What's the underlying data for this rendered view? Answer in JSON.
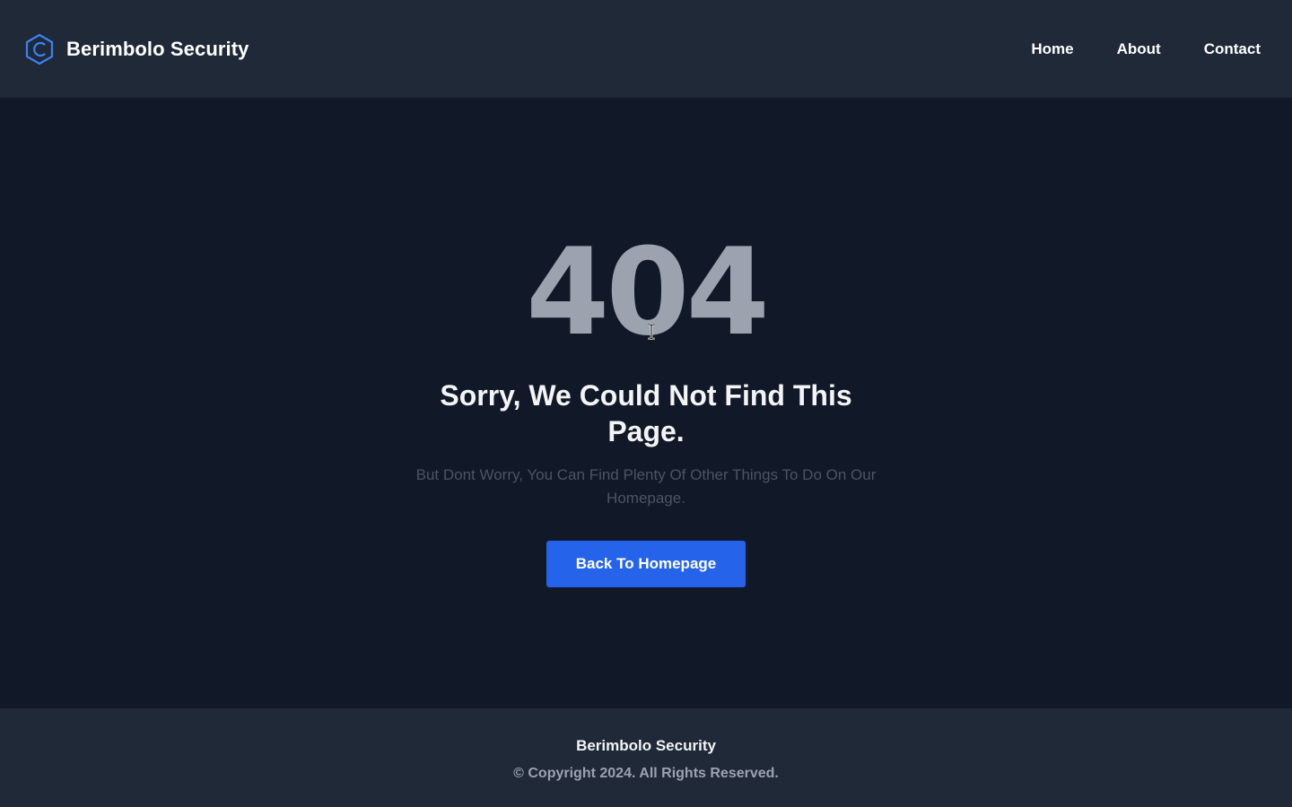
{
  "header": {
    "brand_name": "Berimbolo Security",
    "logo_icon": "hexagon-c-logo-icon",
    "nav": [
      {
        "label": "Home"
      },
      {
        "label": "About"
      },
      {
        "label": "Contact"
      }
    ]
  },
  "main": {
    "error_code": "404",
    "title": "Sorry, We Could Not Find This Page.",
    "subtitle": "But Dont Worry, You Can Find Plenty Of Other Things To Do On Our Homepage.",
    "cta_label": "Back To Homepage",
    "cursor_icon": "text-cursor-icon"
  },
  "footer": {
    "brand_name": "Berimbolo Security",
    "copyright": "© Copyright 2024. All Rights Reserved."
  },
  "colors": {
    "header_bg": "#1f2937",
    "page_bg": "#111827",
    "accent": "#2563eb",
    "logo": "#3b82f6",
    "error_code": "#9ca3af",
    "subtitle": "#4b5563"
  }
}
